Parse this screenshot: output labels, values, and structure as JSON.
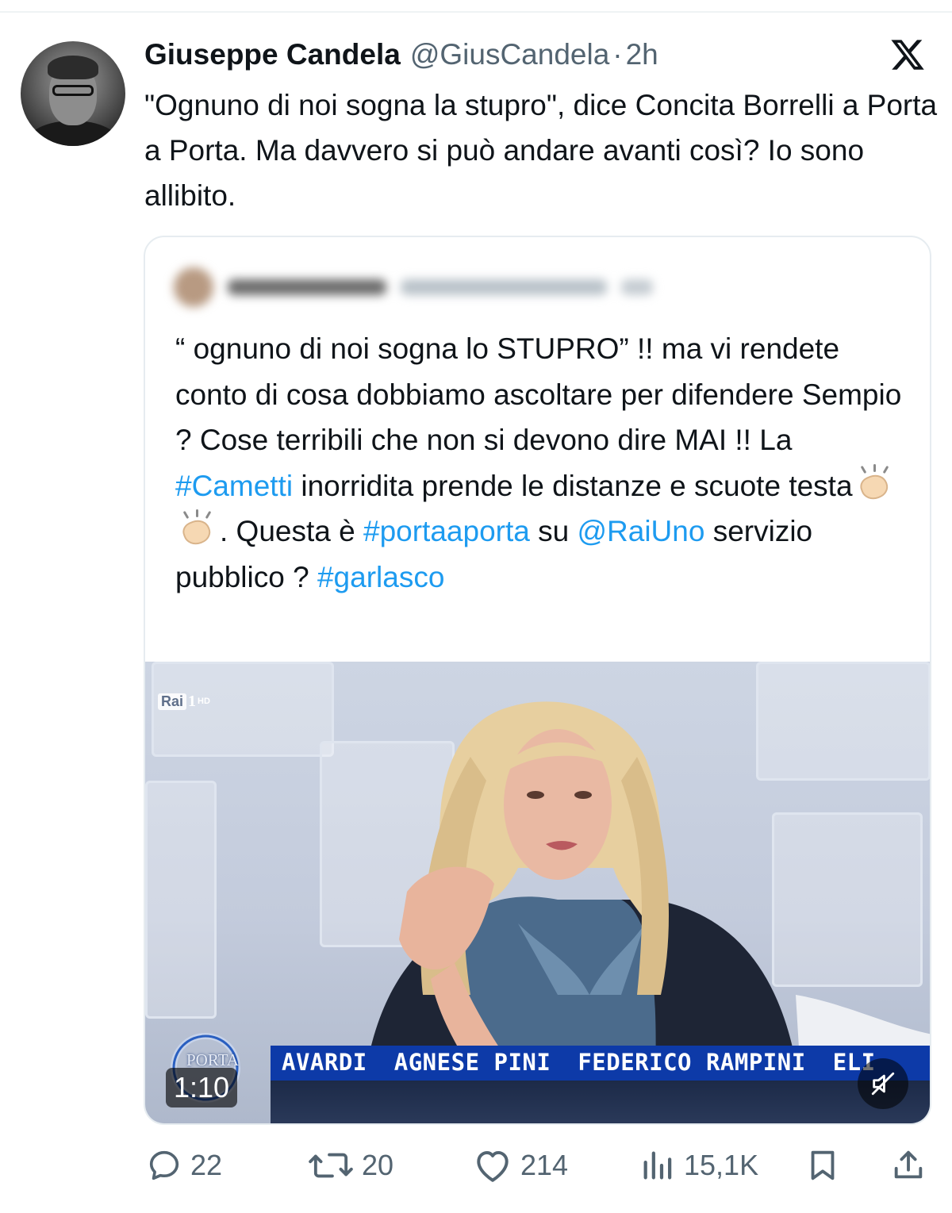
{
  "tweet": {
    "author_name": "Giuseppe Candela",
    "author_handle": "@GiusCandela",
    "separator": "·",
    "time": "2h",
    "text": "\"Ognuno di noi sogna la stupro\", dice Concita Borrelli a Porta a Porta. Ma davvero si può andare avanti così? Io sono allibito."
  },
  "brand_icon": "x-logo-icon",
  "quoted": {
    "line1": "“ ognuno di noi sogna lo STUPRO” !! ma vi rendete conto di cosa dobbiamo ascoltare per difendere Sempio ? Cose terribili che non si devono dire MAI !! La ",
    "tag_cametti": "#Cametti",
    "line2": " inorridita prende le distanze e scuote testa",
    "line2_end": ".",
    "line3": " Questa è ",
    "tag_portaaporta": "#portaaporta",
    "line4": " su ",
    "mention_raiuno": "@RaiUno",
    "line5": " servizio pubblico ? ",
    "tag_garlasco": "#garlasco",
    "emoji": [
      "clapping-hands-icon",
      "clapping-hands-icon"
    ],
    "link_color": "#1d9bf0"
  },
  "video": {
    "channel_logo": "Rai",
    "channel_number": "1",
    "channel_hd": "HD",
    "show_logo": "PORTA",
    "ticker": [
      "AVARDI",
      "AGNESE PINI",
      "FEDERICO RAMPINI",
      "ELI"
    ],
    "duration": "1:10",
    "mute_icon": "muted-speaker-icon"
  },
  "actions": {
    "replies": "22",
    "reposts": "20",
    "likes": "214",
    "views": "15,1K"
  },
  "colors": {
    "text": "#0f1419",
    "secondary": "#536471",
    "accent": "#1d9bf0",
    "ticker_bg": "#0d3aa8"
  }
}
